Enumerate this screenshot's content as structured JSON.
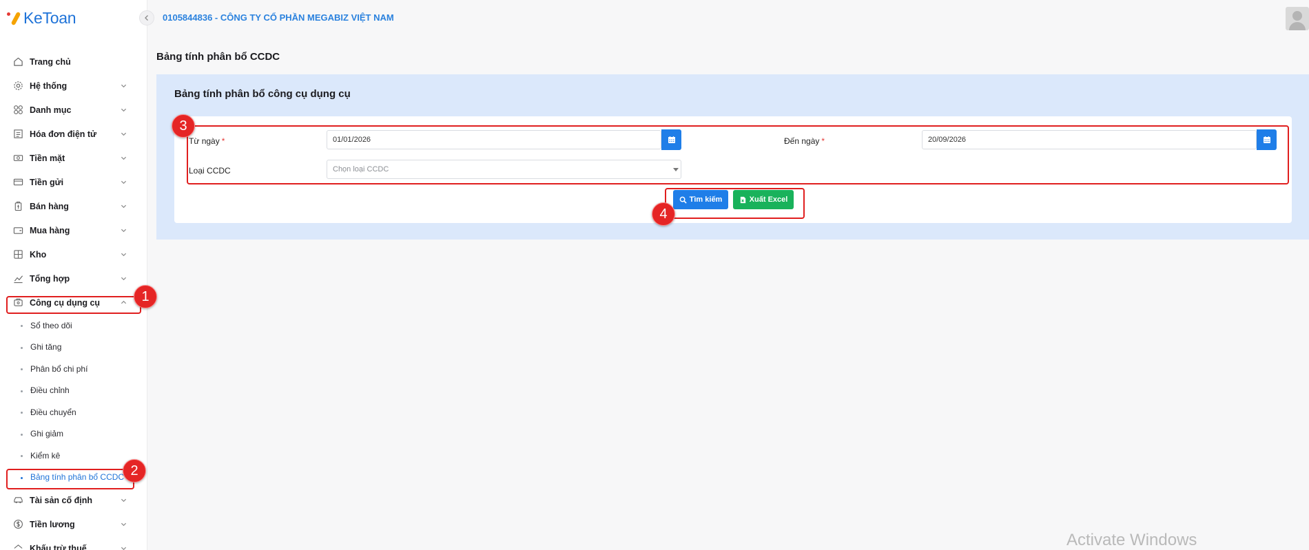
{
  "app": {
    "logo_text": "KeToan"
  },
  "header": {
    "company": "0105844836 - CÔNG TY CỔ PHẦN MEGABIZ VIỆT NAM"
  },
  "sidebar": {
    "items": [
      {
        "label": "Trang chủ",
        "icon": "home-icon"
      },
      {
        "label": "Hệ thống",
        "icon": "gear-icon"
      },
      {
        "label": "Danh mục",
        "icon": "grid-icon"
      },
      {
        "label": "Hóa đơn điện tử",
        "icon": "invoice-icon"
      },
      {
        "label": "Tiền mặt",
        "icon": "cash-icon"
      },
      {
        "label": "Tiền gửi",
        "icon": "bank-icon"
      },
      {
        "label": "Bán hàng",
        "icon": "sales-icon"
      },
      {
        "label": "Mua hàng",
        "icon": "cart-icon"
      },
      {
        "label": "Kho",
        "icon": "warehouse-icon"
      },
      {
        "label": "Tổng hợp",
        "icon": "chart-icon"
      },
      {
        "label": "Công cụ dụng cụ",
        "icon": "tools-icon"
      }
    ],
    "sub_items": [
      "Sổ theo dõi",
      "Ghi tăng",
      "Phân bổ chi phí",
      "Điều chỉnh",
      "Điều chuyển",
      "Ghi giảm",
      "Kiểm kê",
      "Bảng tính phân bổ CCDC"
    ],
    "after_items": [
      {
        "label": "Tài sản cố định",
        "icon": "car-icon"
      },
      {
        "label": "Tiền lương",
        "icon": "dollar-icon"
      },
      {
        "label": "Khấu trừ thuế",
        "icon": "tax-icon"
      }
    ]
  },
  "page": {
    "title": "Bảng tính phân bổ CCDC",
    "panel_title": "Bảng tính phân bổ công cụ dụng cụ"
  },
  "form": {
    "from_label": "Từ ngày",
    "from_value": "01/01/2026",
    "to_label": "Đến ngày",
    "to_value": "20/09/2026",
    "type_label": "Loại CCDC",
    "type_placeholder": "Chọn loại CCDC",
    "required_mark": "*"
  },
  "buttons": {
    "search": "Tìm kiếm",
    "export": "Xuất Excel"
  },
  "annotations": [
    "1",
    "2",
    "3",
    "4"
  ],
  "watermark": "Activate Windows",
  "colors": {
    "primary": "#1f7ee8",
    "success": "#19b25b",
    "annotation": "#e01e1e",
    "panel_bg": "#dbe8fb"
  }
}
